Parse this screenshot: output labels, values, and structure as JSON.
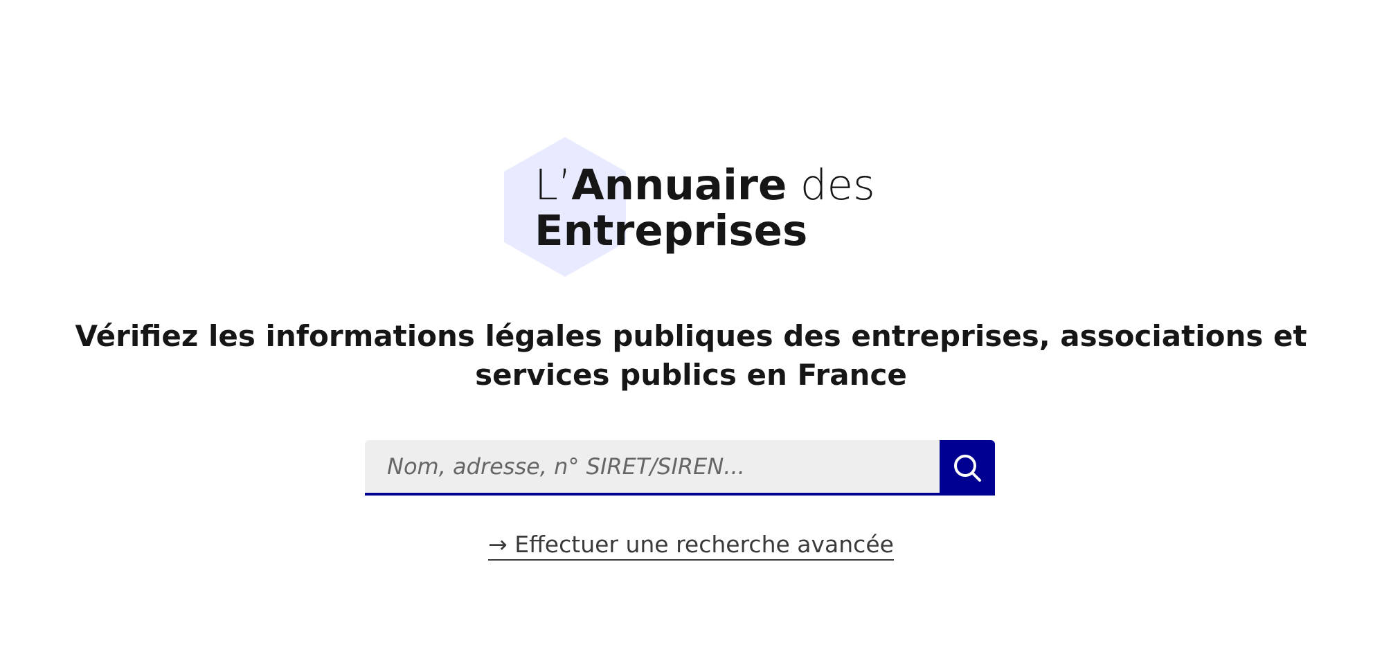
{
  "logo": {
    "prefix": "L’",
    "name_bold": "Annuaire",
    "suffix": " des",
    "line2": "Entreprises",
    "hexagon_color": "#e8ebff"
  },
  "headline": {
    "text": "Vérifiez les informations légales publiques des entreprises, associations et services publics en France"
  },
  "search": {
    "placeholder": "Nom, adresse, n° SIRET/SIREN...",
    "value": "",
    "button_icon": "search-icon",
    "accent_color": "#000091"
  },
  "advanced_search": {
    "arrow": "→",
    "label": "Effectuer une recherche avancée"
  }
}
